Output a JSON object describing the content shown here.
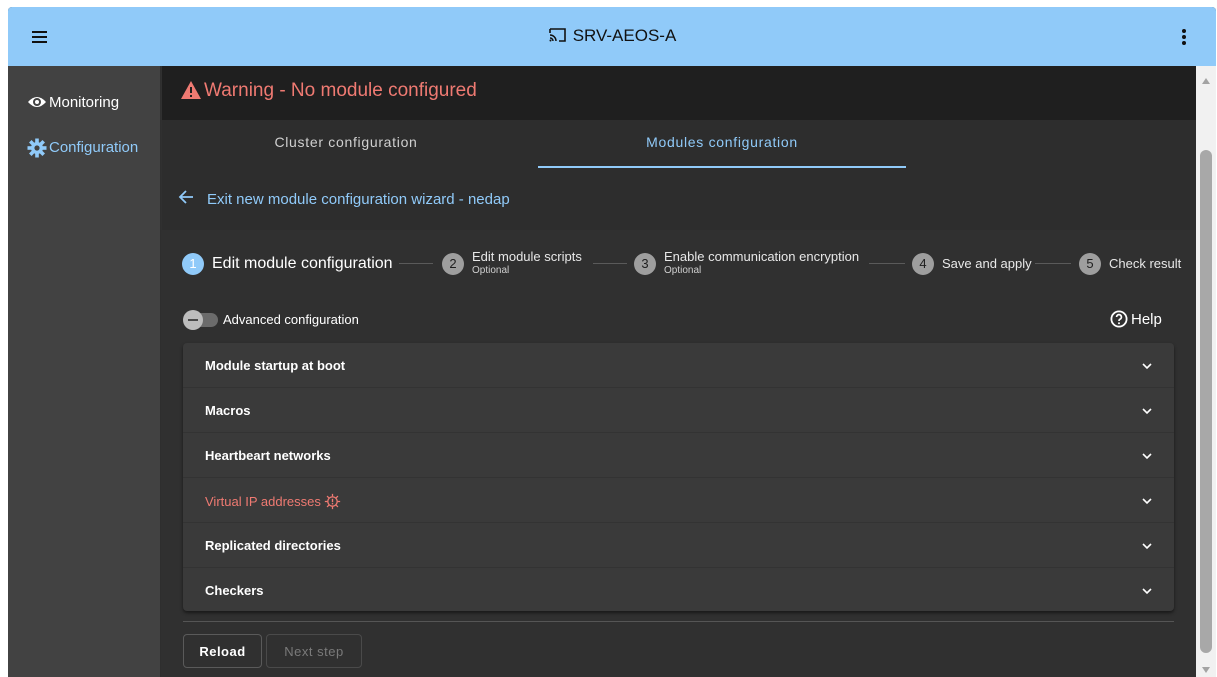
{
  "topbar": {
    "title": "SRV-AEOS-A",
    "menu_icon": "hamburger-menu-icon",
    "title_icon": "cast-icon",
    "more_icon": "more-vertical-icon",
    "bg_color": "#90caf9"
  },
  "sidebar": {
    "items": [
      {
        "label": "Monitoring",
        "icon": "eye-icon",
        "active": false
      },
      {
        "label": "Configuration",
        "icon": "gear-icon",
        "active": true
      }
    ]
  },
  "warning": {
    "text": "Warning - No module configured",
    "icon": "warning-triangle-icon",
    "color": "#ef7a72"
  },
  "tabs": [
    {
      "label": "Cluster configuration",
      "active": false
    },
    {
      "label": "Modules configuration",
      "active": true
    }
  ],
  "back_link": {
    "label": "Exit new module configuration wizard - nedap",
    "icon": "arrow-left-icon"
  },
  "stepper": {
    "steps": [
      {
        "num": "1",
        "label": "Edit module configuration",
        "optional": "",
        "active": true
      },
      {
        "num": "2",
        "label": "Edit module scripts",
        "optional": "Optional",
        "active": false
      },
      {
        "num": "3",
        "label": "Enable communication encryption",
        "optional": "Optional",
        "active": false
      },
      {
        "num": "4",
        "label": "Save and apply",
        "optional": "",
        "active": false
      },
      {
        "num": "5",
        "label": "Check result",
        "optional": "",
        "active": false
      }
    ]
  },
  "advanced": {
    "label": "Advanced configuration",
    "enabled": false
  },
  "help": {
    "label": "Help",
    "icon": "help-circle-icon"
  },
  "panels": [
    {
      "label": "Module startup at boot",
      "warning": false
    },
    {
      "label": "Macros",
      "warning": false
    },
    {
      "label": "Heartbeart networks",
      "warning": false
    },
    {
      "label": "Virtual IP addresses",
      "warning": true,
      "icon": "gear-warning-icon"
    },
    {
      "label": "Replicated directories",
      "warning": false
    },
    {
      "label": "Checkers",
      "warning": false
    }
  ],
  "buttons": {
    "reload": "Reload",
    "next": "Next step"
  },
  "colors": {
    "accent": "#90caf9",
    "warning": "#ef7a72",
    "background": "#303030"
  }
}
